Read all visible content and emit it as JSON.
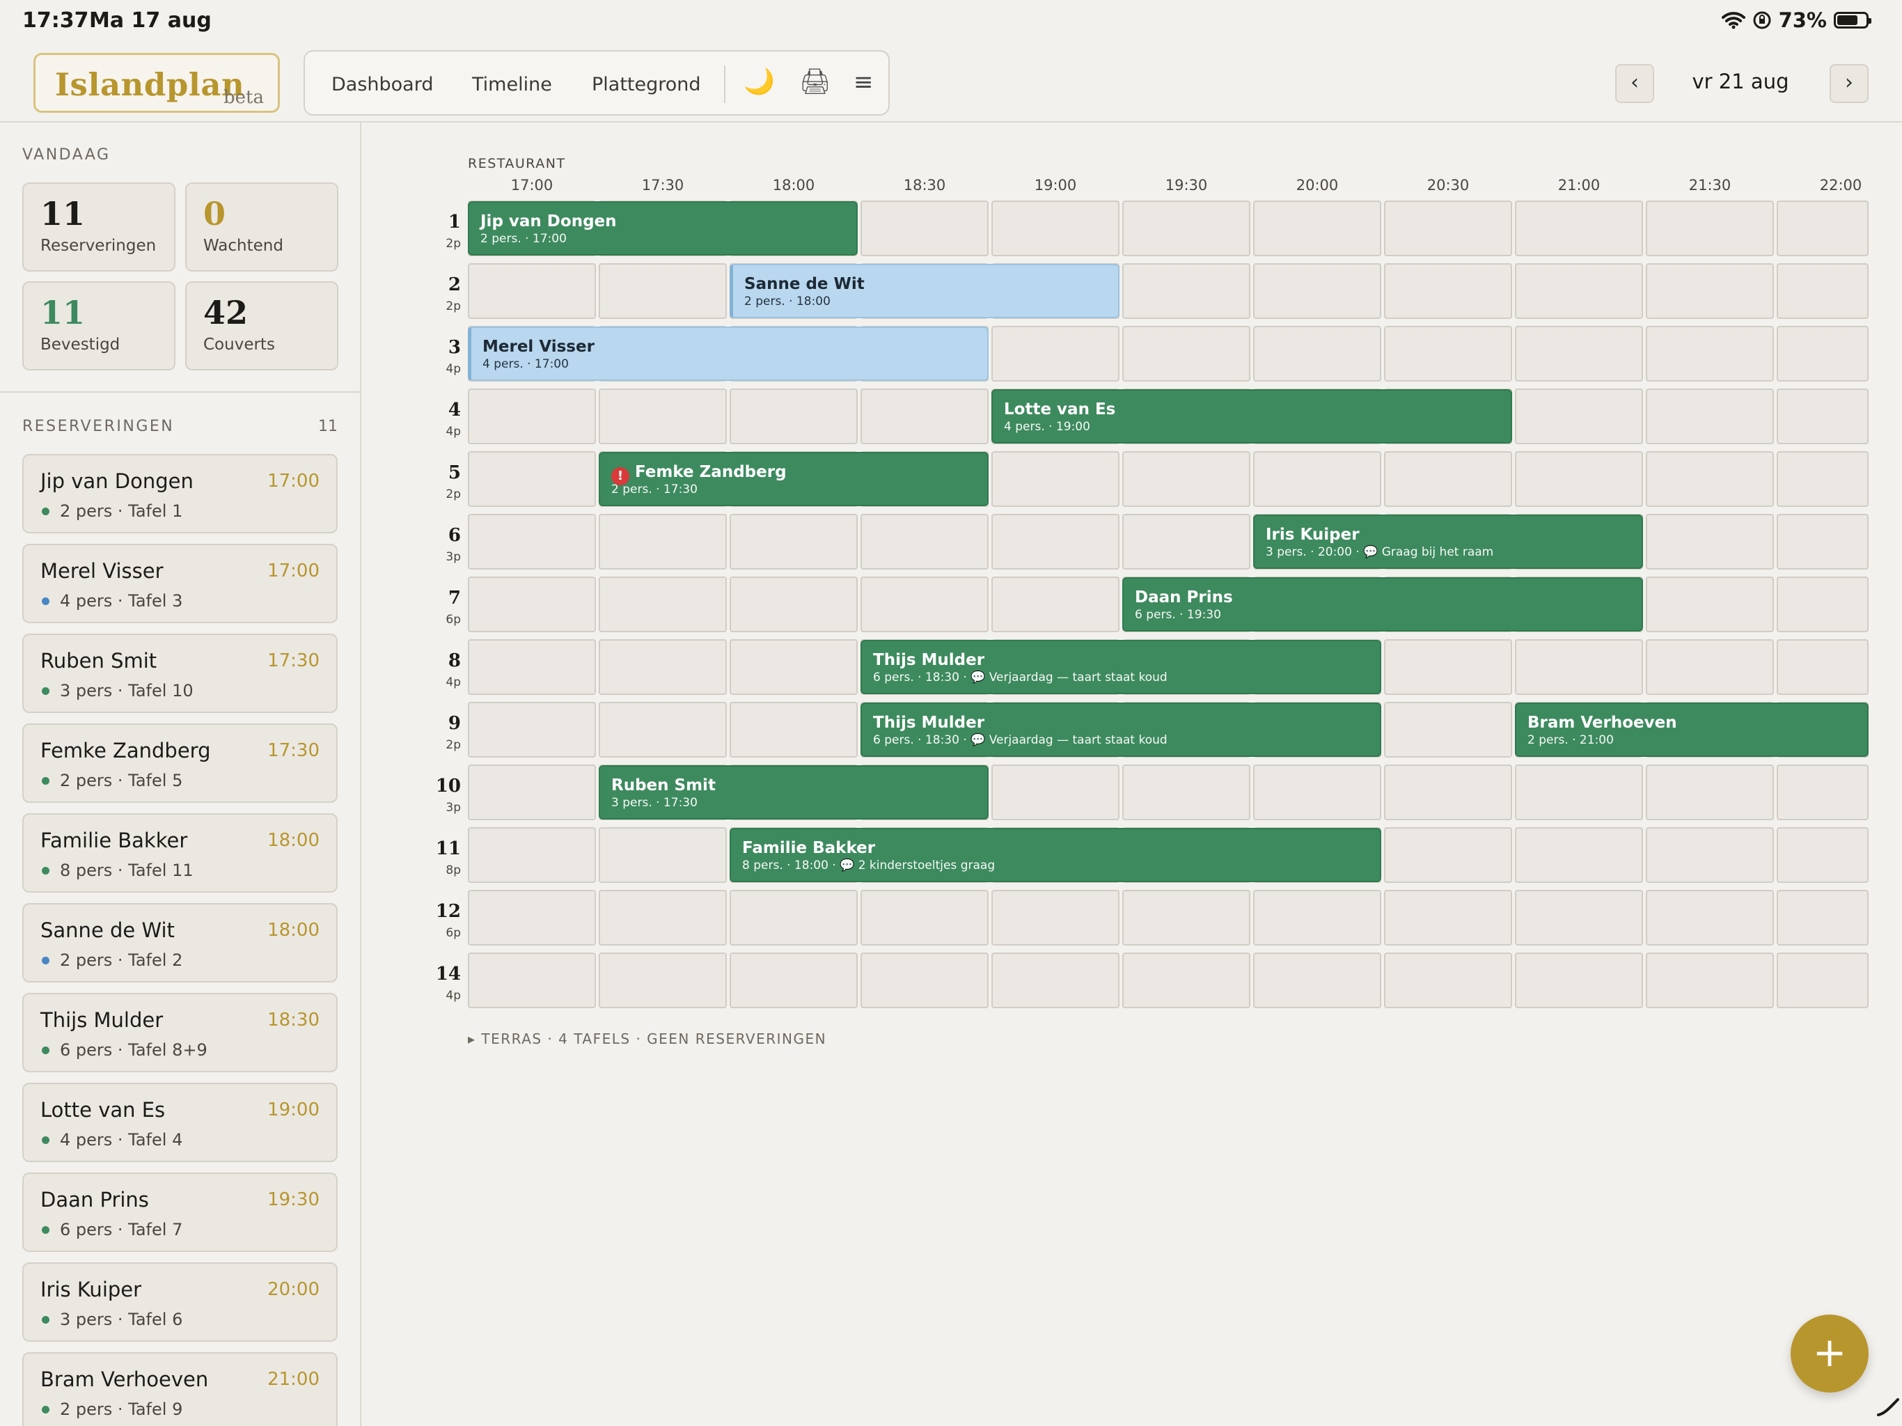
{
  "status_bar": {
    "time": "17:37",
    "date": "Ma 17 aug",
    "battery": "73%",
    "battery_level": 0.73
  },
  "header": {
    "brand": "Islandplan",
    "badge": "beta",
    "nav": [
      "Dashboard",
      "Timeline",
      "Plattegrond"
    ],
    "icons": {
      "theme": "🌙",
      "print": "🖨",
      "menu": "≡"
    },
    "prev": "‹",
    "next": "›",
    "current_date": "vr 21 aug"
  },
  "today": {
    "title": "VANDAAG",
    "stats": [
      {
        "value": "11",
        "label": "Reserveringen",
        "color": "#1d1b18"
      },
      {
        "value": "0",
        "label": "Wachtend",
        "color": "#b8962e"
      },
      {
        "value": "11",
        "label": "Bevestigd",
        "color": "#3d8a5e"
      },
      {
        "value": "42",
        "label": "Couverts",
        "color": "#1d1b18"
      }
    ]
  },
  "reservations": {
    "title": "RESERVERINGEN",
    "count": "11",
    "items": [
      {
        "name": "Jip van Dongen",
        "time": "17:00",
        "meta": "2 pers · Tafel 1",
        "dot": "#3d8a5e"
      },
      {
        "name": "Merel Visser",
        "time": "17:00",
        "meta": "4 pers · Tafel 3",
        "dot": "#4a86c5"
      },
      {
        "name": "Ruben Smit",
        "time": "17:30",
        "meta": "3 pers · Tafel 10",
        "dot": "#3d8a5e"
      },
      {
        "name": "Femke Zandberg",
        "time": "17:30",
        "meta": "2 pers · Tafel 5",
        "dot": "#3d8a5e"
      },
      {
        "name": "Familie Bakker",
        "time": "18:00",
        "meta": "8 pers · Tafel 11",
        "dot": "#3d8a5e"
      },
      {
        "name": "Sanne de Wit",
        "time": "18:00",
        "meta": "2 pers · Tafel 2",
        "dot": "#4a86c5"
      },
      {
        "name": "Thijs Mulder",
        "time": "18:30",
        "meta": "6 pers · Tafel 8+9",
        "dot": "#3d8a5e"
      },
      {
        "name": "Lotte van Es",
        "time": "19:00",
        "meta": "4 pers · Tafel 4",
        "dot": "#3d8a5e"
      },
      {
        "name": "Daan Prins",
        "time": "19:30",
        "meta": "6 pers · Tafel 7",
        "dot": "#3d8a5e"
      },
      {
        "name": "Iris Kuiper",
        "time": "20:00",
        "meta": "3 pers · Tafel 6",
        "dot": "#3d8a5e"
      },
      {
        "name": "Bram Verhoeven",
        "time": "21:00",
        "meta": "2 pers · Tafel 9",
        "dot": "#3d8a5e"
      }
    ]
  },
  "timeline": {
    "section": "RESTAURANT",
    "hours": [
      "17:00",
      "17:30",
      "18:00",
      "18:30",
      "19:00",
      "19:30",
      "20:00",
      "20:30",
      "21:00",
      "21:30",
      "22:00"
    ],
    "tables": [
      {
        "num": "1",
        "cap": "2p"
      },
      {
        "num": "2",
        "cap": "2p"
      },
      {
        "num": "3",
        "cap": "4p"
      },
      {
        "num": "4",
        "cap": "4p"
      },
      {
        "num": "5",
        "cap": "2p"
      },
      {
        "num": "6",
        "cap": "3p"
      },
      {
        "num": "7",
        "cap": "6p"
      },
      {
        "num": "8",
        "cap": "4p"
      },
      {
        "num": "9",
        "cap": "2p"
      },
      {
        "num": "10",
        "cap": "3p"
      },
      {
        "num": "11",
        "cap": "8p"
      },
      {
        "num": "12",
        "cap": "6p"
      },
      {
        "num": "14",
        "cap": "4p"
      }
    ],
    "bookings": [
      {
        "table_index": 0,
        "start": "17:00",
        "slots": 3,
        "status": "confirmed",
        "name": "Jip van Dongen",
        "meta": "2 pers. · 17:00"
      },
      {
        "table_index": 1,
        "start": "18:00",
        "slots": 3,
        "status": "pending",
        "name": "Sanne de Wit",
        "meta": "2 pers. · 18:00"
      },
      {
        "table_index": 2,
        "start": "17:00",
        "slots": 4,
        "status": "pending",
        "name": "Merel Visser",
        "meta": "4 pers. · 17:00"
      },
      {
        "table_index": 3,
        "start": "19:00",
        "slots": 4,
        "status": "confirmed",
        "name": "Lotte van Es",
        "meta": "4 pers. · 19:00"
      },
      {
        "table_index": 4,
        "start": "17:30",
        "slots": 3,
        "status": "confirmed",
        "name": "Femke Zandberg",
        "meta": "2 pers. · 17:30",
        "alert": "!"
      },
      {
        "table_index": 5,
        "start": "20:00",
        "slots": 3,
        "status": "confirmed",
        "name": "Iris Kuiper",
        "meta": "3 pers. · 20:00 · 💬 Graag bij het raam"
      },
      {
        "table_index": 6,
        "start": "19:30",
        "slots": 4,
        "status": "confirmed",
        "name": "Daan Prins",
        "meta": "6 pers. · 19:30"
      },
      {
        "table_index": 7,
        "start": "18:30",
        "slots": 4,
        "status": "confirmed",
        "name": "Thijs Mulder",
        "meta": "6 pers. · 18:30 · 💬 Verjaardag — taart staat koud"
      },
      {
        "table_index": 8,
        "start": "18:30",
        "slots": 4,
        "status": "confirmed",
        "name": "Thijs Mulder",
        "meta": "6 pers. · 18:30 · 💬 Verjaardag — taart staat koud"
      },
      {
        "table_index": 8,
        "start": "21:00",
        "slots": 3,
        "status": "confirmed",
        "name": "Bram Verhoeven",
        "meta": "2 pers. · 21:00"
      },
      {
        "table_index": 9,
        "start": "17:30",
        "slots": 3,
        "status": "confirmed",
        "name": "Ruben Smit",
        "meta": "3 pers. · 17:30"
      },
      {
        "table_index": 10,
        "start": "18:00",
        "slots": 5,
        "status": "confirmed",
        "name": "Familie Bakker",
        "meta": "8 pers. · 18:00 · 💬 2 kinderstoeltjes graag"
      }
    ],
    "terras": "▸  TERRAS · 4 TAFELS · GEEN RESERVERINGEN"
  },
  "fab_label": "+"
}
